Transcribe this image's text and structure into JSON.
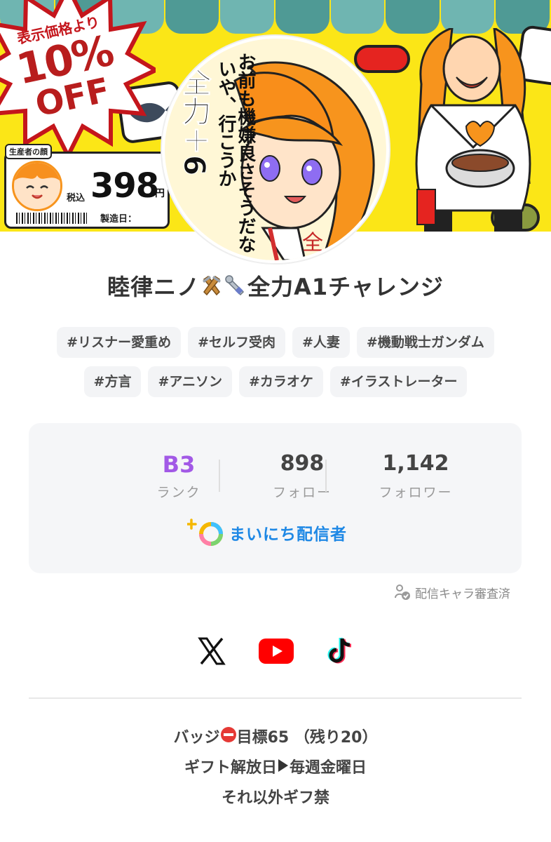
{
  "banner": {
    "discount": {
      "line1": "表示価格より",
      "line2": "10%",
      "line3": "OFF"
    },
    "price_tag": {
      "producer_label": "生産者の顔",
      "tax_label": "税込",
      "price": "398",
      "currency": "円",
      "made_label": "製造日："
    },
    "avatar_text": {
      "line1": "お前も機嫌良さそうだな",
      "line2": "いや、行こうか",
      "line3": "全力＋6",
      "corner": "全"
    }
  },
  "profile": {
    "name_part1": "睦律ニノ",
    "name_part2": "全力A1チャレンジ",
    "tags": [
      "#リスナー愛重め",
      "#セルフ受肉",
      "#人妻",
      "#機動戦士ガンダム",
      "#方言",
      "#アニソン",
      "#カラオケ",
      "#イラストレーター"
    ]
  },
  "stats": {
    "rank": {
      "value": "B3",
      "label": "ランク"
    },
    "follow": {
      "value": "898",
      "label": "フォロー"
    },
    "follower": {
      "value": "1,142",
      "label": "フォロワー"
    },
    "daily_label": "まいにち配信者"
  },
  "verified_label": "配信キャラ審査済",
  "socials": {
    "x": "x-icon",
    "youtube": "youtube-icon",
    "tiktok": "tiktok-icon"
  },
  "bio": {
    "line1_a": "バッジ",
    "line1_b": "目標65 （残り20）",
    "line2_a": "ギフト解放日",
    "line2_b": "毎週金曜日",
    "line3": "それ以外ギフ禁"
  },
  "colors": {
    "banner_bg": "#fbe617",
    "awning": "#4f9a95",
    "rank": "#a259e6",
    "daily": "#1e88e5",
    "youtube": "#ff0000"
  }
}
